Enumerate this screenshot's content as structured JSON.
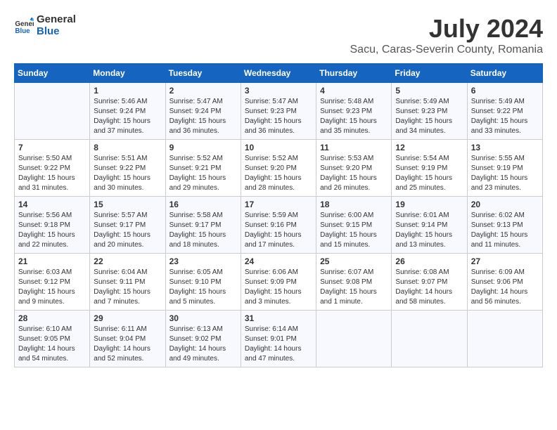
{
  "header": {
    "logo_general": "General",
    "logo_blue": "Blue",
    "month_year": "July 2024",
    "location": "Sacu, Caras-Severin County, Romania"
  },
  "weekdays": [
    "Sunday",
    "Monday",
    "Tuesday",
    "Wednesday",
    "Thursday",
    "Friday",
    "Saturday"
  ],
  "weeks": [
    [
      {
        "day": "",
        "sunrise": "",
        "sunset": "",
        "daylight": ""
      },
      {
        "day": "1",
        "sunrise": "Sunrise: 5:46 AM",
        "sunset": "Sunset: 9:24 PM",
        "daylight": "Daylight: 15 hours and 37 minutes."
      },
      {
        "day": "2",
        "sunrise": "Sunrise: 5:47 AM",
        "sunset": "Sunset: 9:24 PM",
        "daylight": "Daylight: 15 hours and 36 minutes."
      },
      {
        "day": "3",
        "sunrise": "Sunrise: 5:47 AM",
        "sunset": "Sunset: 9:23 PM",
        "daylight": "Daylight: 15 hours and 36 minutes."
      },
      {
        "day": "4",
        "sunrise": "Sunrise: 5:48 AM",
        "sunset": "Sunset: 9:23 PM",
        "daylight": "Daylight: 15 hours and 35 minutes."
      },
      {
        "day": "5",
        "sunrise": "Sunrise: 5:49 AM",
        "sunset": "Sunset: 9:23 PM",
        "daylight": "Daylight: 15 hours and 34 minutes."
      },
      {
        "day": "6",
        "sunrise": "Sunrise: 5:49 AM",
        "sunset": "Sunset: 9:22 PM",
        "daylight": "Daylight: 15 hours and 33 minutes."
      }
    ],
    [
      {
        "day": "7",
        "sunrise": "Sunrise: 5:50 AM",
        "sunset": "Sunset: 9:22 PM",
        "daylight": "Daylight: 15 hours and 31 minutes."
      },
      {
        "day": "8",
        "sunrise": "Sunrise: 5:51 AM",
        "sunset": "Sunset: 9:22 PM",
        "daylight": "Daylight: 15 hours and 30 minutes."
      },
      {
        "day": "9",
        "sunrise": "Sunrise: 5:52 AM",
        "sunset": "Sunset: 9:21 PM",
        "daylight": "Daylight: 15 hours and 29 minutes."
      },
      {
        "day": "10",
        "sunrise": "Sunrise: 5:52 AM",
        "sunset": "Sunset: 9:20 PM",
        "daylight": "Daylight: 15 hours and 28 minutes."
      },
      {
        "day": "11",
        "sunrise": "Sunrise: 5:53 AM",
        "sunset": "Sunset: 9:20 PM",
        "daylight": "Daylight: 15 hours and 26 minutes."
      },
      {
        "day": "12",
        "sunrise": "Sunrise: 5:54 AM",
        "sunset": "Sunset: 9:19 PM",
        "daylight": "Daylight: 15 hours and 25 minutes."
      },
      {
        "day": "13",
        "sunrise": "Sunrise: 5:55 AM",
        "sunset": "Sunset: 9:19 PM",
        "daylight": "Daylight: 15 hours and 23 minutes."
      }
    ],
    [
      {
        "day": "14",
        "sunrise": "Sunrise: 5:56 AM",
        "sunset": "Sunset: 9:18 PM",
        "daylight": "Daylight: 15 hours and 22 minutes."
      },
      {
        "day": "15",
        "sunrise": "Sunrise: 5:57 AM",
        "sunset": "Sunset: 9:17 PM",
        "daylight": "Daylight: 15 hours and 20 minutes."
      },
      {
        "day": "16",
        "sunrise": "Sunrise: 5:58 AM",
        "sunset": "Sunset: 9:17 PM",
        "daylight": "Daylight: 15 hours and 18 minutes."
      },
      {
        "day": "17",
        "sunrise": "Sunrise: 5:59 AM",
        "sunset": "Sunset: 9:16 PM",
        "daylight": "Daylight: 15 hours and 17 minutes."
      },
      {
        "day": "18",
        "sunrise": "Sunrise: 6:00 AM",
        "sunset": "Sunset: 9:15 PM",
        "daylight": "Daylight: 15 hours and 15 minutes."
      },
      {
        "day": "19",
        "sunrise": "Sunrise: 6:01 AM",
        "sunset": "Sunset: 9:14 PM",
        "daylight": "Daylight: 15 hours and 13 minutes."
      },
      {
        "day": "20",
        "sunrise": "Sunrise: 6:02 AM",
        "sunset": "Sunset: 9:13 PM",
        "daylight": "Daylight: 15 hours and 11 minutes."
      }
    ],
    [
      {
        "day": "21",
        "sunrise": "Sunrise: 6:03 AM",
        "sunset": "Sunset: 9:12 PM",
        "daylight": "Daylight: 15 hours and 9 minutes."
      },
      {
        "day": "22",
        "sunrise": "Sunrise: 6:04 AM",
        "sunset": "Sunset: 9:11 PM",
        "daylight": "Daylight: 15 hours and 7 minutes."
      },
      {
        "day": "23",
        "sunrise": "Sunrise: 6:05 AM",
        "sunset": "Sunset: 9:10 PM",
        "daylight": "Daylight: 15 hours and 5 minutes."
      },
      {
        "day": "24",
        "sunrise": "Sunrise: 6:06 AM",
        "sunset": "Sunset: 9:09 PM",
        "daylight": "Daylight: 15 hours and 3 minutes."
      },
      {
        "day": "25",
        "sunrise": "Sunrise: 6:07 AM",
        "sunset": "Sunset: 9:08 PM",
        "daylight": "Daylight: 15 hours and 1 minute."
      },
      {
        "day": "26",
        "sunrise": "Sunrise: 6:08 AM",
        "sunset": "Sunset: 9:07 PM",
        "daylight": "Daylight: 14 hours and 58 minutes."
      },
      {
        "day": "27",
        "sunrise": "Sunrise: 6:09 AM",
        "sunset": "Sunset: 9:06 PM",
        "daylight": "Daylight: 14 hours and 56 minutes."
      }
    ],
    [
      {
        "day": "28",
        "sunrise": "Sunrise: 6:10 AM",
        "sunset": "Sunset: 9:05 PM",
        "daylight": "Daylight: 14 hours and 54 minutes."
      },
      {
        "day": "29",
        "sunrise": "Sunrise: 6:11 AM",
        "sunset": "Sunset: 9:04 PM",
        "daylight": "Daylight: 14 hours and 52 minutes."
      },
      {
        "day": "30",
        "sunrise": "Sunrise: 6:13 AM",
        "sunset": "Sunset: 9:02 PM",
        "daylight": "Daylight: 14 hours and 49 minutes."
      },
      {
        "day": "31",
        "sunrise": "Sunrise: 6:14 AM",
        "sunset": "Sunset: 9:01 PM",
        "daylight": "Daylight: 14 hours and 47 minutes."
      },
      {
        "day": "",
        "sunrise": "",
        "sunset": "",
        "daylight": ""
      },
      {
        "day": "",
        "sunrise": "",
        "sunset": "",
        "daylight": ""
      },
      {
        "day": "",
        "sunrise": "",
        "sunset": "",
        "daylight": ""
      }
    ]
  ]
}
